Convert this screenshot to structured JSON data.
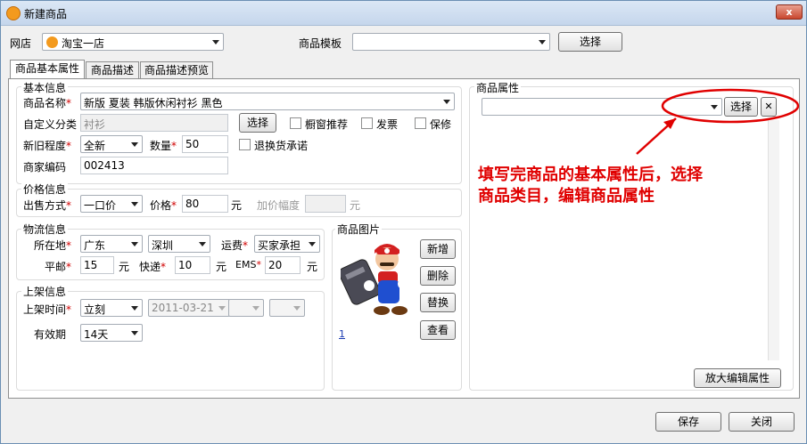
{
  "window": {
    "title": "新建商品",
    "close_label": "x"
  },
  "shop": {
    "label": "网店",
    "value": "淘宝一店"
  },
  "template": {
    "label": "商品模板",
    "value": "",
    "select_label": "选择"
  },
  "tabs": [
    {
      "label": "商品基本属性"
    },
    {
      "label": "商品描述"
    },
    {
      "label": "商品描述预览"
    }
  ],
  "basic": {
    "title": "基本信息",
    "name_label": "商品名称",
    "name_value": "新版 夏装 韩版休闲衬衫 黑色",
    "category_label": "自定义分类",
    "category_value": "衬衫",
    "category_btn": "选择",
    "window_rec": "橱窗推荐",
    "invoice": "发票",
    "warranty": "保修",
    "condition_label": "新旧程度",
    "condition_value": "全新",
    "qty_label": "数量",
    "qty_value": "50",
    "return_label": "退换货承诺",
    "code_label": "商家编码",
    "code_value": "002413"
  },
  "price": {
    "title": "价格信息",
    "method_label": "出售方式",
    "method_value": "一口价",
    "price_label": "价格",
    "price_value": "80",
    "unit": "元",
    "markup_label": "加价幅度",
    "markup_value": "",
    "markup_unit": "元"
  },
  "logistics": {
    "title": "物流信息",
    "location_label": "所在地",
    "province": "广东",
    "city": "深圳",
    "fee_label": "运费",
    "fee_value": "买家承担",
    "post_label": "平邮",
    "post_value": "15",
    "express_label": "快递",
    "express_value": "10",
    "ems_label": "EMS",
    "ems_value": "20",
    "unit": "元"
  },
  "listing": {
    "title": "上架信息",
    "time_label": "上架时间",
    "time_value": "立刻",
    "date_value": "2011-03-21",
    "validity_label": "有效期",
    "validity_value": "14天"
  },
  "images": {
    "title": "商品图片",
    "index": "1",
    "add": "新增",
    "delete": "删除",
    "replace": "替换",
    "view": "查看"
  },
  "attributes": {
    "title": "商品属性",
    "select_label": "选择",
    "clear_label": "✕",
    "expand_label": "放大编辑属性",
    "annotation": "填写完商品的基本属性后，选择\n商品类目，编辑商品属性"
  },
  "footer": {
    "save": "保存",
    "close": "关闭"
  },
  "colors": {
    "annotation": "#e00000",
    "shop_icon": "#f39a1e"
  }
}
